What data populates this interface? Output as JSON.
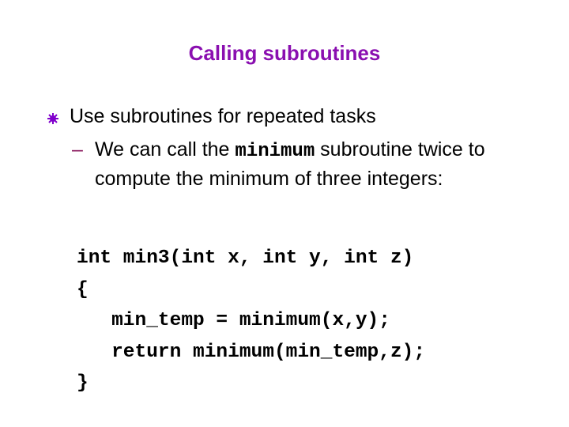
{
  "slide": {
    "title": "Calling subroutines",
    "bullet": {
      "icon": "asterisk-bullet-icon",
      "text": "Use subroutines for repeated tasks"
    },
    "sub_bullet": {
      "dash": "–",
      "text_before": "We can call the ",
      "code_word": "minimum",
      "text_after": " subroutine twice to compute the minimum of three integers:"
    },
    "code_lines": [
      "int min3(int x, int y, int z)",
      "{",
      "   min_temp = minimum(x,y);",
      "   return minimum(min_temp,z);",
      "}"
    ],
    "colors": {
      "title": "#8a0fb0",
      "bullet": "#8000cc",
      "dash": "#8b1a5e"
    }
  }
}
